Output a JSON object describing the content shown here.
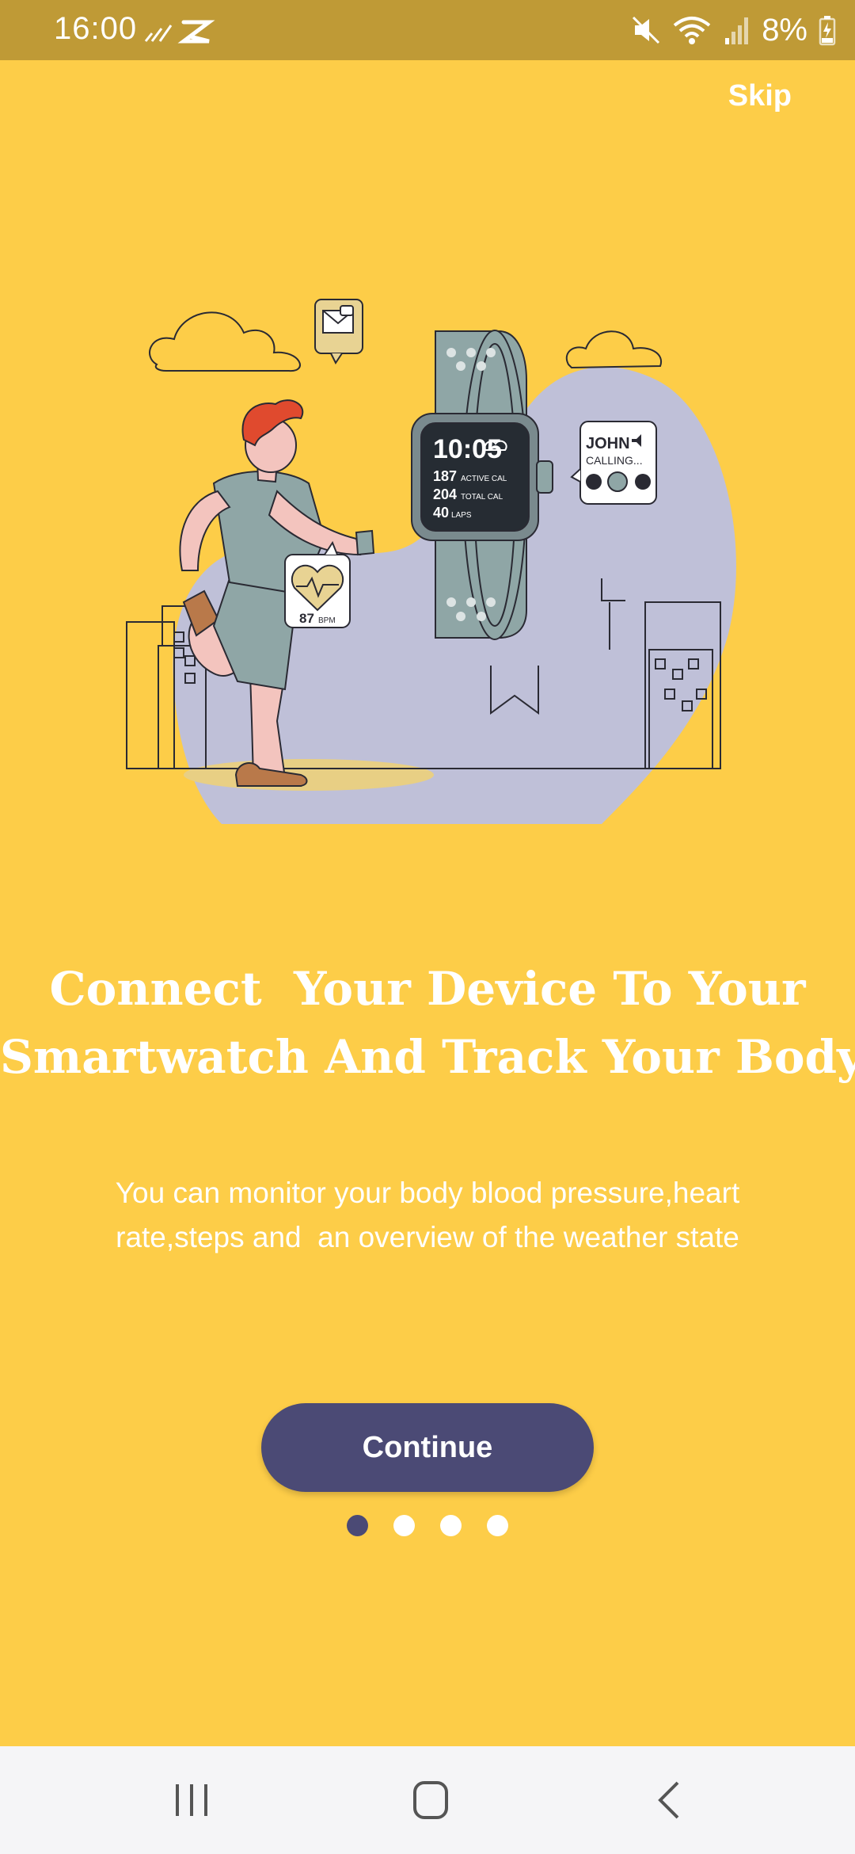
{
  "status_bar": {
    "time": "16:00",
    "battery_percent": "8%",
    "icons": [
      "signal-bars-icon",
      "capcut-icon",
      "mute-icon",
      "wifi-icon",
      "cell-signal-icon",
      "battery-charging-icon"
    ]
  },
  "skip_label": "Skip",
  "illustration": {
    "watch_time": "10:05",
    "active_cal": "187",
    "active_cal_label": "ACTIVE CAL",
    "total_cal": "204",
    "total_cal_label": "TOTAL CAL",
    "laps": "40",
    "laps_label": "LAPS",
    "caller_name": "JOHN",
    "caller_status": "CALLING...",
    "heart_rate": "87",
    "heart_rate_unit": "BPM"
  },
  "headline": {
    "line1": "Connect  Your Device To Your",
    "line2": "Smartwatch And Track Your Body"
  },
  "subtitle": {
    "line1": "You can monitor your body blood pressure,heart",
    "line2": "rate,steps and  an overview of the weather state"
  },
  "continue_label": "Continue",
  "pager": {
    "total": 4,
    "active_index": 0
  },
  "colors": {
    "background": "#FDCD48",
    "status_bar": "#BF9A36",
    "primary_button": "#4B4A75",
    "blob": "#BFC0D8",
    "watch_band": "#8FA6A6"
  }
}
